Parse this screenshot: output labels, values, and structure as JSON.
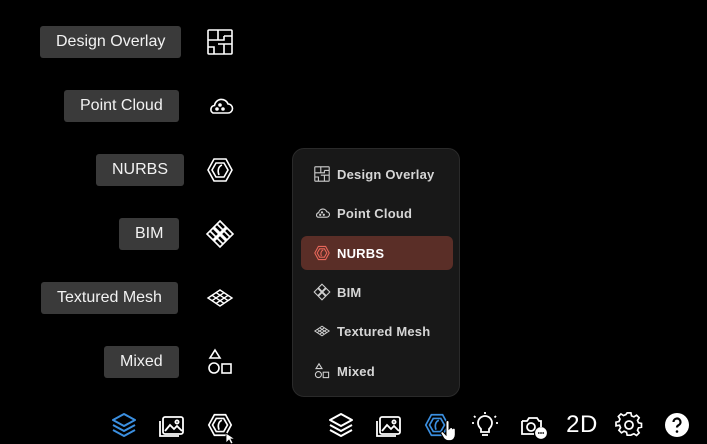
{
  "side_labels": [
    {
      "text": "Design Overlay",
      "icon": "design-overlay-icon"
    },
    {
      "text": "Point Cloud",
      "icon": "point-cloud-icon"
    },
    {
      "text": "NURBS",
      "icon": "nurbs-icon"
    },
    {
      "text": "BIM",
      "icon": "bim-icon"
    },
    {
      "text": "Textured Mesh",
      "icon": "textured-mesh-icon"
    },
    {
      "text": "Mixed",
      "icon": "mixed-icon"
    }
  ],
  "menu": {
    "items": [
      {
        "label": "Design Overlay",
        "icon": "design-overlay-icon"
      },
      {
        "label": "Point Cloud",
        "icon": "point-cloud-icon"
      },
      {
        "label": "NURBS",
        "icon": "nurbs-icon",
        "selected": true
      },
      {
        "label": "BIM",
        "icon": "bim-icon"
      },
      {
        "label": "Textured Mesh",
        "icon": "textured-mesh-icon"
      },
      {
        "label": "Mixed",
        "icon": "mixed-icon"
      }
    ]
  },
  "toolbar": {
    "view_mode_label": "2D",
    "icons": [
      "layers-icon",
      "gallery-icon",
      "nurbs-icon",
      "lightbulb-icon",
      "camera-icon",
      "settings-icon",
      "help-icon"
    ]
  },
  "colors": {
    "accent_blue": "#3b8fe0",
    "selected_bg": "#5a2e27",
    "selected_icon": "#e8675a",
    "label_bg": "#3a3a3a"
  }
}
